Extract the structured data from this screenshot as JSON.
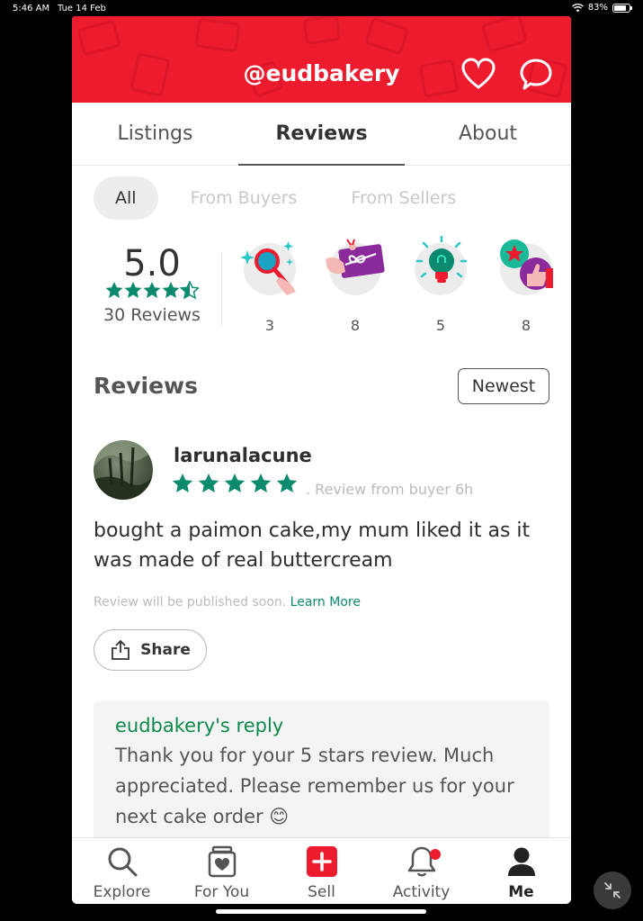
{
  "status_bar": {
    "time": "5:46 AM",
    "date": "Tue 14 Feb",
    "battery": "83%",
    "battery_level": 0.83
  },
  "header": {
    "title": "@eudbakery",
    "favorite_icon": "heart-icon",
    "message_icon": "chat-bubble-icon",
    "brand_color": "#ec1c2e"
  },
  "tabs": [
    {
      "label": "Listings",
      "active": false
    },
    {
      "label": "Reviews",
      "active": true
    },
    {
      "label": "About",
      "active": false
    }
  ],
  "filters": [
    {
      "label": "All",
      "active": true
    },
    {
      "label": "From Buyers",
      "active": false
    },
    {
      "label": "From Sellers",
      "active": false
    }
  ],
  "rating": {
    "score": "5.0",
    "stars": 4.5,
    "count_label": "30 Reviews"
  },
  "badges": [
    {
      "icon": "magnifier-sparkle-icon",
      "count": "3"
    },
    {
      "icon": "gift-card-icon",
      "count": "8"
    },
    {
      "icon": "lightbulb-icon",
      "count": "5"
    },
    {
      "icon": "star-thumbs-up-icon",
      "count": "8"
    }
  ],
  "reviews_section": {
    "heading": "Reviews",
    "sort_label": "Newest"
  },
  "review": {
    "username": "larunalacune",
    "stars": 5,
    "meta": ". Review from buyer  6h",
    "text": "bought a paimon cake,my mum liked it as it was made of real buttercream",
    "notice": "Review will be published soon.",
    "notice_link": "Learn More",
    "share_label": "Share"
  },
  "reply": {
    "title": "eudbakery's reply",
    "text": "Thank you for your 5 stars review. Much appreciated. Please remember us for your next cake order 😊"
  },
  "bottom_nav": [
    {
      "label": "Explore",
      "icon": "search-icon",
      "active": false
    },
    {
      "label": "For You",
      "icon": "jar-heart-icon",
      "active": false
    },
    {
      "label": "Sell",
      "icon": "plus-square-icon",
      "active": false
    },
    {
      "label": "Activity",
      "icon": "bell-icon",
      "active": false,
      "has_dot": true
    },
    {
      "label": "Me",
      "icon": "person-icon",
      "active": true
    }
  ],
  "accent_green": "#0b8a6e"
}
